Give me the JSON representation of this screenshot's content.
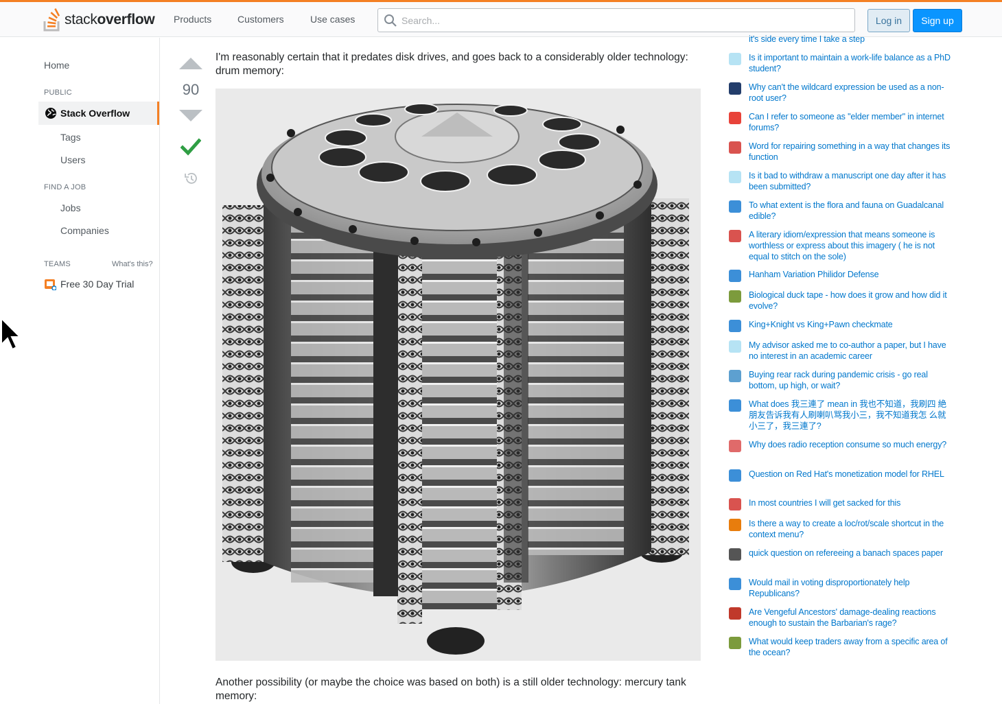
{
  "header": {
    "logo_word_light": "stack",
    "logo_word_bold": "overflow",
    "nav": [
      "Products",
      "Customers",
      "Use cases"
    ],
    "search_placeholder": "Search...",
    "login_label": "Log in",
    "signup_label": "Sign up",
    "accent": "#f48024"
  },
  "sidebar": {
    "home": "Home",
    "public_heading": "PUBLIC",
    "active_item": "Stack Overflow",
    "items": [
      "Tags",
      "Users"
    ],
    "find_job_heading": "FIND A JOB",
    "job_items": [
      "Jobs",
      "Companies"
    ],
    "teams_heading": "TEAMS",
    "whats_this": "What's this?",
    "trial": "Free 30 Day Trial"
  },
  "post": {
    "vote_count": "90",
    "accepted": true,
    "paragraph_1": "I'm reasonably certain that it predates disk drives, and goes back to a considerably older technology: drum memory:",
    "image_subject": "drum memory",
    "paragraph_2": "Another possibility (or maybe the choice was based on both) is a still older technology: mercury tank memory:"
  },
  "hot_network_questions": {
    "partial_top": "it's side every time I take a step",
    "items": [
      {
        "title": "Is it important to maintain a work-life balance as a PhD student?",
        "icon": "academia-icon",
        "color": "#b6e3f4"
      },
      {
        "title": "Why can't the wildcard expression be used as a non-root user?",
        "icon": "unix-icon",
        "color": "#233d6b"
      },
      {
        "title": "Can I refer to someone as \"elder member\" in internet forums?",
        "icon": "english-icon",
        "color": "#e8433a"
      },
      {
        "title": "Word for repairing something in a way that changes its function",
        "icon": "ell-icon",
        "color": "#d9534f"
      },
      {
        "title": "Is it bad to withdraw a manuscript one day after it has been submitted?",
        "icon": "academia-icon",
        "color": "#b6e3f4"
      },
      {
        "title": "To what extent is the flora and fauna on Guadalcanal edible?",
        "icon": "outdoors-icon",
        "color": "#3c8fd8"
      },
      {
        "title": "A literary idiom/expression that means someone is worthless or express about this imagery ( he is not equal to stitch on the sole)",
        "icon": "ell-icon",
        "color": "#d9534f"
      },
      {
        "title": "Hanham Variation Philidor Defense",
        "icon": "chess-icon",
        "color": "#3c8fd8"
      },
      {
        "title": "Biological duck tape - how does it grow and how did it evolve?",
        "icon": "biology-icon",
        "color": "#7c9b3c"
      },
      {
        "title": "King+Knight vs King+Pawn checkmate",
        "icon": "chess-icon",
        "color": "#3c8fd8"
      },
      {
        "title": "My advisor asked me to co-author a paper, but I have no interest in an academic career",
        "icon": "academia-icon",
        "color": "#b6e3f4"
      },
      {
        "title": "Buying rear rack during pandemic crisis - go real bottom, up high, or wait?",
        "icon": "bicycles-icon",
        "color": "#5da0d0"
      },
      {
        "title": "What does 我三連了 mean in 我也不知道，我刷四 絶朋友告诉我有人刷喇叭骂我小三，我不知道我怎 么就小三了，我三連了?",
        "icon": "chinese-icon",
        "color": "#3c8fd8"
      },
      {
        "title": "Why does radio reception consume so much energy?",
        "icon": "electronics-icon",
        "color": "#e06a6a"
      },
      {
        "title": "Question on Red Hat's monetization model for RHEL",
        "icon": "opensource-icon",
        "color": "#3c8fd8"
      },
      {
        "title": "In most countries I will get sacked for this",
        "icon": "workplace-icon",
        "color": "#d9534f"
      },
      {
        "title": "Is there a way to create a loc/rot/scale shortcut in the context menu?",
        "icon": "blender-icon",
        "color": "#e87d0d"
      },
      {
        "title": "quick question on refereeing a banach spaces paper",
        "icon": "mathoverflow-icon",
        "color": "#555555"
      },
      {
        "title": "Would mail in voting disproportionately help Republicans?",
        "icon": "politics-icon",
        "color": "#3c8fd8"
      },
      {
        "title": "Are Vengeful Ancestors' damage-dealing reactions enough to sustain the Barbarian's rage?",
        "icon": "rpg-icon",
        "color": "#c0392b"
      },
      {
        "title": "What would keep traders away from a specific area of the ocean?",
        "icon": "worldbuilding-icon",
        "color": "#7c9b3c"
      }
    ]
  }
}
